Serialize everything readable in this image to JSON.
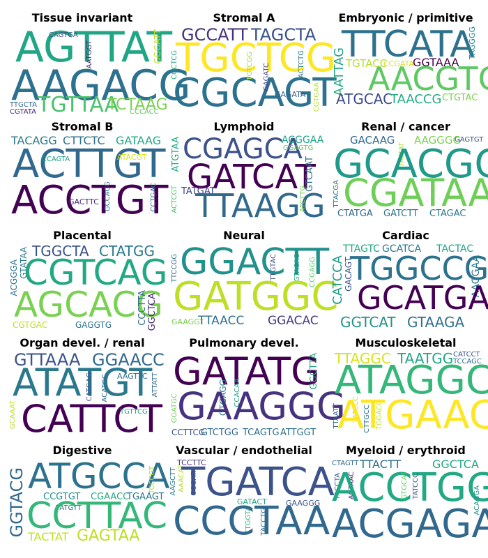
{
  "panels": [
    {
      "title": "Tissue invariant",
      "words": [
        {
          "text": "AGTTAT",
          "color": "#21a685"
        },
        {
          "text": "AAGACG",
          "color": "#2c718e"
        },
        {
          "text": "TGTTAA",
          "color": "#4ac16d"
        },
        {
          "text": "TCTAAG",
          "color": "#7ad151"
        },
        {
          "text": "CAGTGA",
          "color": "#39568c"
        },
        {
          "text": "AATGGT",
          "color": "#482475"
        },
        {
          "text": "GGGATT",
          "color": "#bddf26"
        },
        {
          "text": "TTGCTA",
          "color": "#31688e"
        },
        {
          "text": "CGTATA",
          "color": "#482878"
        },
        {
          "text": "CCCACC",
          "color": "#5ec962"
        }
      ]
    },
    {
      "title": "Stromal A",
      "words": [
        {
          "text": "GCCATT",
          "color": "#46327e"
        },
        {
          "text": "TAGCTA",
          "color": "#3b528b"
        },
        {
          "text": "TGCTCG",
          "color": "#fde725"
        },
        {
          "text": "CGCAGT",
          "color": "#2c728e"
        },
        {
          "text": "CGCTCG",
          "color": "#20a486"
        },
        {
          "text": "TGTCGG",
          "color": "#a5db36"
        },
        {
          "text": "GAGATC",
          "color": "#414487"
        },
        {
          "text": "GAGATA",
          "color": "#35608d"
        },
        {
          "text": "ACTCTG",
          "color": "#2a788e"
        },
        {
          "text": "CGTGAA",
          "color": "#b5de2b"
        }
      ]
    },
    {
      "title": "Embryonic / primitive",
      "words": [
        {
          "text": "TTCATA",
          "color": "#2c728e"
        },
        {
          "text": "AACGTG",
          "color": "#5ec962"
        },
        {
          "text": "AATTAG",
          "color": "#22a884"
        },
        {
          "text": "TGTACC",
          "color": "#b5de2b"
        },
        {
          "text": "CCGATA",
          "color": "#d8e219"
        },
        {
          "text": "GGTAAA",
          "color": "#440154"
        },
        {
          "text": "TAGGGG",
          "color": "#238a8d"
        },
        {
          "text": "ATGCAC",
          "color": "#3e4a89"
        },
        {
          "text": "TAACCG",
          "color": "#25ab82"
        },
        {
          "text": "CTGTAC",
          "color": "#7ad151"
        }
      ]
    },
    {
      "title": "Stromal B",
      "words": [
        {
          "text": "TACAGG",
          "color": "#2a788e"
        },
        {
          "text": "CTTCTC",
          "color": "#2c718e"
        },
        {
          "text": "GATAAG",
          "color": "#22a884"
        },
        {
          "text": "ACTTGT",
          "color": "#31688e"
        },
        {
          "text": "CCAGTA",
          "color": "#1fa187"
        },
        {
          "text": "ATACGT",
          "color": "#d8e219"
        },
        {
          "text": "ACCTGT",
          "color": "#440154"
        },
        {
          "text": "GACTTC",
          "color": "#482878"
        },
        {
          "text": "GCCACG",
          "color": "#2a788e"
        },
        {
          "text": "CCTGAC",
          "color": "#2c718e"
        }
      ]
    },
    {
      "title": "Lymphoid",
      "words": [
        {
          "text": "CGAGCA",
          "color": "#3b528b"
        },
        {
          "text": "ACGGAA",
          "color": "#20a486"
        },
        {
          "text": "GGAGTG",
          "color": "#5ec962"
        },
        {
          "text": "ATGTAA",
          "color": "#22a884"
        },
        {
          "text": "GATCAT",
          "color": "#440154"
        },
        {
          "text": "ACTCGT",
          "color": "#4ac16d"
        },
        {
          "text": "TATGAT",
          "color": "#414487"
        },
        {
          "text": "TTAAGG",
          "color": "#31688e"
        },
        {
          "text": "GTCAAT",
          "color": "#2c718e"
        },
        {
          "text": "ATCTTG",
          "color": "#7ad151"
        }
      ]
    },
    {
      "title": "Renal / cancer",
      "words": [
        {
          "text": "GACAAG",
          "color": "#31688e"
        },
        {
          "text": "AAGGGG",
          "color": "#7ad151"
        },
        {
          "text": "GAGTGT",
          "color": "#3b528b"
        },
        {
          "text": "TATTAT",
          "color": "#b5de2b"
        },
        {
          "text": "GCACGG",
          "color": "#1f9a8a"
        },
        {
          "text": "TTACGA",
          "color": "#2a788e"
        },
        {
          "text": "CGATAA",
          "color": "#6ece58"
        },
        {
          "text": "CTATGA",
          "color": "#31688e"
        },
        {
          "text": "GATCTT",
          "color": "#2c718e"
        },
        {
          "text": "CTAGAC",
          "color": "#2a788e"
        }
      ]
    },
    {
      "title": "Placental",
      "words": [
        {
          "text": "TGGCTA",
          "color": "#3b528b"
        },
        {
          "text": "CTATGG",
          "color": "#2a788e"
        },
        {
          "text": "ACGGGA",
          "color": "#2c718e"
        },
        {
          "text": "GTATAA",
          "color": "#2a788e"
        },
        {
          "text": "CGTCAG",
          "color": "#22a884"
        },
        {
          "text": "AGCACG",
          "color": "#7ad151"
        },
        {
          "text": "CCCTTA",
          "color": "#31688e"
        },
        {
          "text": "GGCTCA",
          "color": "#472d7b"
        },
        {
          "text": "CGTGAC",
          "color": "#bddf26"
        },
        {
          "text": "GAGGTG",
          "color": "#2c718e"
        }
      ]
    },
    {
      "title": "Neural",
      "words": [
        {
          "text": "GGACTT",
          "color": "#21918c"
        },
        {
          "text": "TTCCGG",
          "color": "#31688e"
        },
        {
          "text": "TTGTAC",
          "color": "#3b528b"
        },
        {
          "text": "GTACAC",
          "color": "#22a884"
        },
        {
          "text": "CCGAGG",
          "color": "#5ec962"
        },
        {
          "text": "GATGGC",
          "color": "#bddf26"
        },
        {
          "text": "GAAGGT",
          "color": "#7ad151"
        },
        {
          "text": "TTAACC",
          "color": "#2c718e"
        },
        {
          "text": "GGACAC",
          "color": "#443983"
        }
      ]
    },
    {
      "title": "Cardiac",
      "words": [
        {
          "text": "TTAGTC",
          "color": "#22a884"
        },
        {
          "text": "GCATCA",
          "color": "#2a788e"
        },
        {
          "text": "TACTAC",
          "color": "#20a486"
        },
        {
          "text": "CATCCA",
          "color": "#1f9a8a"
        },
        {
          "text": "GACAGT",
          "color": "#3b528b"
        },
        {
          "text": "TGGCCG",
          "color": "#2c728e"
        },
        {
          "text": "AAGGAA",
          "color": "#2a788e"
        },
        {
          "text": "GCATGA",
          "color": "#440154"
        },
        {
          "text": "GGTCAT",
          "color": "#21918c"
        },
        {
          "text": "GTAAGA",
          "color": "#2c718e"
        }
      ]
    },
    {
      "title": "Organ devel. / renal",
      "words": [
        {
          "text": "GTTAAA",
          "color": "#3b528b"
        },
        {
          "text": "GGAACC",
          "color": "#31688e"
        },
        {
          "text": "ATATGT",
          "color": "#2a788e"
        },
        {
          "text": "CATGAG",
          "color": "#3b528b"
        },
        {
          "text": "ACATGC",
          "color": "#31688e"
        },
        {
          "text": "AAGTTC",
          "color": "#2c718e"
        },
        {
          "text": "ATTATT",
          "color": "#31688e"
        },
        {
          "text": "GCAAAT",
          "color": "#bddf26"
        },
        {
          "text": "CATTCT",
          "color": "#440154"
        },
        {
          "text": "TGTTCG",
          "color": "#22a884"
        }
      ]
    },
    {
      "title": "Pulmonary devel.",
      "words": [
        {
          "text": "GATATG",
          "color": "#440154"
        },
        {
          "text": "GGCTTA",
          "color": "#22a884"
        },
        {
          "text": "GTGAGG",
          "color": "#2a788e"
        },
        {
          "text": "CCACAA",
          "color": "#22a884"
        },
        {
          "text": "GGATGC",
          "color": "#6ece58"
        },
        {
          "text": "GAAGGG",
          "color": "#46327e"
        },
        {
          "text": "CCTTCG",
          "color": "#3b528b"
        },
        {
          "text": "GTCTGG",
          "color": "#31688e"
        },
        {
          "text": "TCAGTG",
          "color": "#2c718e"
        },
        {
          "text": "ATTGGT",
          "color": "#2c718e"
        }
      ]
    },
    {
      "title": "Musculoskeletal",
      "words": [
        {
          "text": "TTAGGC",
          "color": "#d8e219"
        },
        {
          "text": "TAATGG",
          "color": "#22a884"
        },
        {
          "text": "CATCCT",
          "color": "#3b528b"
        },
        {
          "text": "TCCAGC",
          "color": "#2c718e"
        },
        {
          "text": "ATAGGC",
          "color": "#35b779"
        },
        {
          "text": "TTAATT",
          "color": "#31688e"
        },
        {
          "text": "TATCCC",
          "color": "#bddf26"
        },
        {
          "text": "CTTGCC",
          "color": "#2c718e"
        },
        {
          "text": "TGGACC",
          "color": "#bddf26"
        },
        {
          "text": "ATGAAC",
          "color": "#fde725"
        }
      ]
    },
    {
      "title": "Digestive",
      "words": [
        {
          "text": "GGTACG",
          "color": "#31688e"
        },
        {
          "text": "ATGCCA",
          "color": "#2c718e"
        },
        {
          "text": "TCCCGT",
          "color": "#b5de2b"
        },
        {
          "text": "CCGTGT",
          "color": "#21918c"
        },
        {
          "text": "CGAACC",
          "color": "#22a884"
        },
        {
          "text": "TGAAGT",
          "color": "#2a788e"
        },
        {
          "text": "TATGTT",
          "color": "#31688e"
        },
        {
          "text": "CCTTAC",
          "color": "#35b779"
        },
        {
          "text": "TACTAT",
          "color": "#bddf26"
        },
        {
          "text": "GAGTAA",
          "color": "#bddf26"
        }
      ]
    },
    {
      "title": "Vascular / endothelial",
      "words": [
        {
          "text": "TCCTTC",
          "color": "#472d7b"
        },
        {
          "text": "AAGCTT",
          "color": "#2a788e"
        },
        {
          "text": "AAACAT",
          "color": "#b5de2b"
        },
        {
          "text": "CGGATA",
          "color": "#2c718e"
        },
        {
          "text": "TGATCA",
          "color": "#3b528b"
        },
        {
          "text": "GATACT",
          "color": "#22a884"
        },
        {
          "text": "GAAGGG",
          "color": "#3b528b"
        },
        {
          "text": "CTGGTA",
          "color": "#35b779"
        },
        {
          "text": "TACCTG",
          "color": "#2c718e"
        },
        {
          "text": "CCCTAA",
          "color": "#31688e"
        }
      ]
    },
    {
      "title": "Myeloid / erythroid",
      "words": [
        {
          "text": "CTAGTT",
          "color": "#31688e"
        },
        {
          "text": "TTACTT",
          "color": "#2c718e"
        },
        {
          "text": "GGCTCA",
          "color": "#22a884"
        },
        {
          "text": "TACCTA",
          "color": "#3b528b"
        },
        {
          "text": "AGTAAC",
          "color": "#482878"
        },
        {
          "text": "ACCTGG",
          "color": "#22a884"
        },
        {
          "text": "GTGCAT",
          "color": "#5ec962"
        },
        {
          "text": "TATCCC",
          "color": "#3b528b"
        },
        {
          "text": "ACAGGA",
          "color": "#21918c"
        },
        {
          "text": "ACGAGA",
          "color": "#31688e"
        }
      ]
    }
  ]
}
